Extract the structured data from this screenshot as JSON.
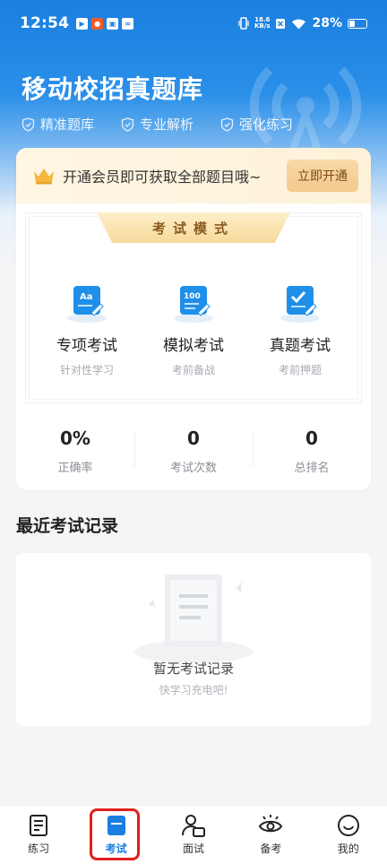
{
  "status_bar": {
    "time": "12:54",
    "net_speed_value": "18.6",
    "net_speed_unit": "KB/s",
    "battery": "28%"
  },
  "header": {
    "app_title": "移动校招真题库",
    "features": [
      "精准题库",
      "专业解析",
      "强化练习"
    ]
  },
  "vip": {
    "text": "开通会员即可获取全部题目哦~",
    "button": "立即开通"
  },
  "exam_mode": {
    "title": "考试模式",
    "modes": [
      {
        "title": "专项考试",
        "subtitle": "针对性学习",
        "icon": "Aa"
      },
      {
        "title": "模拟考试",
        "subtitle": "考前备战",
        "icon": "100"
      },
      {
        "title": "真题考试",
        "subtitle": "考前押题",
        "icon": "check"
      }
    ]
  },
  "stats": [
    {
      "value": "0%",
      "label": "正确率"
    },
    {
      "value": "0",
      "label": "考试次数"
    },
    {
      "value": "0",
      "label": "总排名"
    }
  ],
  "recent": {
    "title": "最近考试记录",
    "empty_title": "暂无考试记录",
    "empty_sub": "快学习充电吧!"
  },
  "bottom_nav": {
    "items": [
      {
        "label": "练习",
        "icon": "practice-icon"
      },
      {
        "label": "考试",
        "icon": "exam-icon",
        "active": true
      },
      {
        "label": "面试",
        "icon": "interview-icon"
      },
      {
        "label": "备考",
        "icon": "prepare-icon"
      },
      {
        "label": "我的",
        "icon": "profile-icon"
      }
    ]
  },
  "colors": {
    "primary": "#1a7fe0",
    "gold": "#f7d99c",
    "highlight": "#e0201c"
  }
}
